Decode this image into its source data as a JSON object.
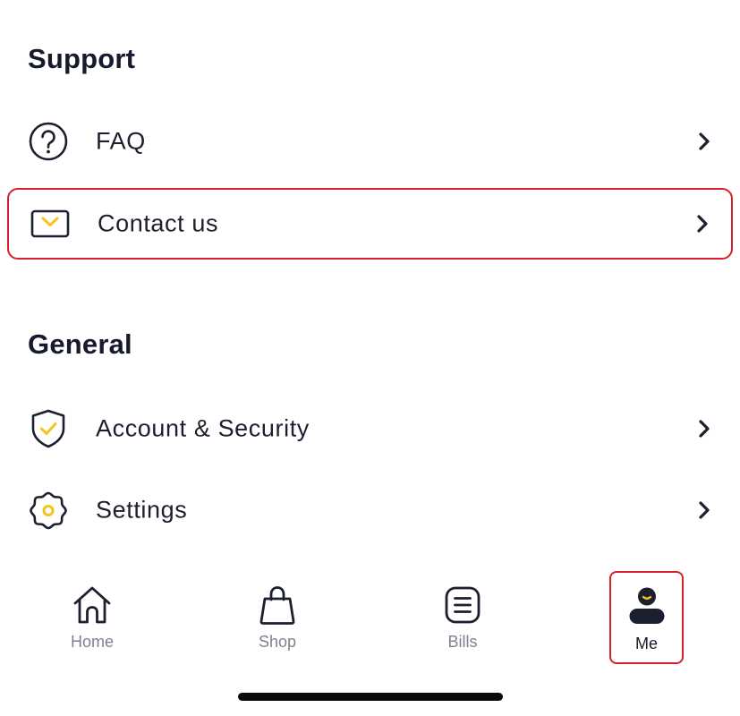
{
  "support": {
    "title": "Support",
    "items": [
      {
        "label": "FAQ",
        "icon": "question-circle-icon"
      },
      {
        "label": "Contact us",
        "icon": "envelope-icon"
      }
    ]
  },
  "general": {
    "title": "General",
    "items": [
      {
        "label": "Account & Security",
        "icon": "shield-check-icon"
      },
      {
        "label": "Settings",
        "icon": "gear-icon"
      }
    ]
  },
  "tabbar": {
    "tabs": [
      {
        "label": "Home",
        "icon": "home-icon"
      },
      {
        "label": "Shop",
        "icon": "shopping-bag-icon"
      },
      {
        "label": "Bills",
        "icon": "bill-icon"
      },
      {
        "label": "Me",
        "icon": "user-icon",
        "active": true
      }
    ]
  },
  "colors": {
    "text": "#1b1f2e",
    "accent_yellow": "#f6c21b",
    "highlight_red": "#d8202c",
    "inactive_tab": "#7e8192"
  }
}
